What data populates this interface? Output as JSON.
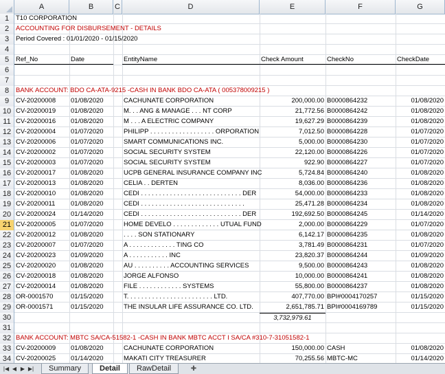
{
  "columns": [
    "A",
    "B",
    "C",
    "D",
    "E",
    "F",
    "G"
  ],
  "rows": {
    "1": {
      "a": "T10 CORPORATION"
    },
    "2": {
      "a": "ACCOUNTING FOR DISBURSEMENT - DETAILS"
    },
    "3": {
      "a": "Period Covered : 01/01/2020 - 01/15/2020"
    },
    "5": {
      "a": "Ref_No",
      "b": "Date",
      "d": "EntityName",
      "e": "Check Amount",
      "f": "CheckNo",
      "g": "CheckDate"
    },
    "8": {
      "a": "BANK ACCOUNT:  BDO CA-ATA-9215 -CASH IN BANK BDO CA-ATA ( 005378009215 )"
    },
    "9": {
      "a": "CV-20200008",
      "b": "01/08/2020",
      "d": "CACHUNATE CORPORATION",
      "e": "200,000.00",
      "f": "B0000864232",
      "g": "01/08/2020"
    },
    "10": {
      "a": "CV-20200019",
      "b": "01/08/2020",
      "d": "M. . . ANG & MANAGE . . . NT CORP",
      "e": "21,772.56",
      "f": "B0000864242",
      "g": "01/08/2020"
    },
    "11": {
      "a": "CV-20200016",
      "b": "01/08/2020",
      "d": "M . . . A ELECTRIC COMPANY",
      "e": "19,627.29",
      "f": "B0000864239",
      "g": "01/08/2020"
    },
    "12": {
      "a": "CV-20200004",
      "b": "01/07/2020",
      "d": "PHILIPP . . . . . . . . . . . . . . . . . . ORPORATION",
      "e": "7,012.50",
      "f": "B0000864228",
      "g": "01/07/2020"
    },
    "13": {
      "a": "CV-20200006",
      "b": "01/07/2020",
      "d": "SMART COMMUNICATIONS INC.",
      "e": "5,000.00",
      "f": "B0000864230",
      "g": "01/07/2020"
    },
    "14": {
      "a": "CV-20200002",
      "b": "01/07/2020",
      "d": "SOCIAL SECURITY SYSTEM",
      "e": "22,120.00",
      "f": "B0000864226",
      "g": "01/07/2020"
    },
    "15": {
      "a": "CV-20200003",
      "b": "01/07/2020",
      "d": "SOCIAL SECURITY SYSTEM",
      "e": "922.90",
      "f": "B0000864227",
      "g": "01/07/2020"
    },
    "16": {
      "a": "CV-20200017",
      "b": "01/08/2020",
      "d": "UCPB GENERAL INSURANCE COMPANY INC",
      "e": "5,724.84",
      "f": "B0000864240",
      "g": "01/08/2020"
    },
    "17": {
      "a": "CV-20200013",
      "b": "01/08/2020",
      "d": "CELIA . . DERTEN",
      "e": "8,036.00",
      "f": "B0000864236",
      "g": "01/08/2020"
    },
    "18": {
      "a": "CV-20200010",
      "b": "01/08/2020",
      "d": "CEDI . . . . . . . . . . . . . . . . . . . . . . . . . . . . DER",
      "e": "54,000.00",
      "f": "B0000864233",
      "g": "01/08/2020"
    },
    "19": {
      "a": "CV-20200011",
      "b": "01/08/2020",
      "d": "CEDI . . . . . . . . . . . . . . . . . . . . . . . . . . . . .",
      "e": "25,471.28",
      "f": "B0000864234",
      "g": "01/08/2020"
    },
    "20": {
      "a": "CV-20200024",
      "b": "01/14/2020",
      "d": "CEDI . . . . . . . . . . . . . . . . . . . . . . . . . . . . DER",
      "e": "192,692.50",
      "f": "B0000864245",
      "g": "01/14/2020"
    },
    "21": {
      "a": "CV-20200005",
      "b": "01/07/2020",
      "d": "HOME DEVELO . . . . . . . . . . . . . UTUAL FUND",
      "e": "2,000.00",
      "f": "B0000864229",
      "g": "01/07/2020"
    },
    "22": {
      "a": "CV-20200012",
      "b": "01/08/2020",
      "d": ". . . . SON STATIONARY",
      "e": "6,142.17",
      "f": "B0000864235",
      "g": "01/08/2020"
    },
    "23": {
      "a": "CV-20200007",
      "b": "01/07/2020",
      "d": "A . . . . . . . . . . . . . TING CO",
      "e": "3,781.49",
      "f": "B0000864231",
      "g": "01/07/2020"
    },
    "24": {
      "a": "CV-20200023",
      "b": "01/09/2020",
      "d": "A . . . . . . . . . . . INC",
      "e": "23,820.37",
      "f": "B0000864244",
      "g": "01/09/2020"
    },
    "25": {
      "a": "CV-20200020",
      "b": "01/08/2020",
      "d": "AU . . . . . . . . . . ACCOUNTING SERVICES",
      "e": "9,500.00",
      "f": "B0000864243",
      "g": "01/08/2020"
    },
    "26": {
      "a": "CV-20200018",
      "b": "01/08/2020",
      "d": "JORGE ALFONSO",
      "e": "10,000.00",
      "f": "B0000864241",
      "g": "01/08/2020"
    },
    "27": {
      "a": "CV-20200014",
      "b": "01/08/2020",
      "d": "FILE . . . . . . . . . . . . SYSTEMS",
      "e": "55,800.00",
      "f": "B0000864237",
      "g": "01/08/2020"
    },
    "28": {
      "a": "OR-0001570",
      "b": "01/15/2020",
      "d": "T. . . . . . . . . . . . . . . . . . . . . . . . LTD.",
      "e": "407,770.00",
      "f": "BPI#0004170257",
      "g": "01/15/2020"
    },
    "29": {
      "a": "OR-0001571",
      "b": "01/15/2020",
      "d": "THE INSULAR LIFE ASSURANCE CO. LTD.",
      "e": "2,651,785.71",
      "f": "BPI#0004169789",
      "g": "01/15/2020"
    },
    "30": {
      "e": "3,732,979.61"
    },
    "32": {
      "a": "BANK ACCOUNT:  MBTC SA/CA-51582-1 -CASH IN BANK MBTC ACCT I  SA/CA #310-7-31051582-1"
    },
    "33": {
      "a": "CV-20200009",
      "b": "01/08/2020",
      "d": "CACHUNATE CORPORATION",
      "e": "150,000.00",
      "f": "CASH",
      "g": "01/08/2020"
    },
    "34": {
      "a": "CV-20200025",
      "b": "01/14/2020",
      "d": "MAKATI CITY TREASURER",
      "e": "70,255.56",
      "f": "MBTC-MC",
      "g": "01/14/2020"
    }
  },
  "selected_row": "21",
  "tabs": [
    "Summary",
    "Detail",
    "RawDetail"
  ],
  "active_tab": "Detail",
  "colors": {
    "accent_red": "#c00000",
    "selected_row_header": "#f7d36f",
    "grid": "#d9dde3"
  }
}
